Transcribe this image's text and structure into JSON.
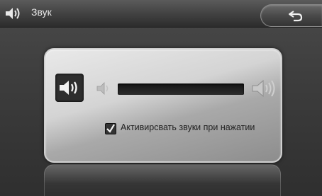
{
  "header": {
    "title": "Звук",
    "title_icon": "speaker-icon",
    "back_icon": "back-arrow-icon"
  },
  "panel": {
    "speaker_icon": "speaker-icon",
    "volume": {
      "min_icon": "volume-low-icon",
      "max_icon": "volume-high-icon",
      "level_fraction": 0
    },
    "touch_sounds": {
      "checked": true,
      "label": "Активирсвать звуки при нажатии"
    }
  },
  "colors": {
    "background": "#3a3a3a",
    "panel": "#d4d4d4",
    "track": "#1e1e1e"
  }
}
